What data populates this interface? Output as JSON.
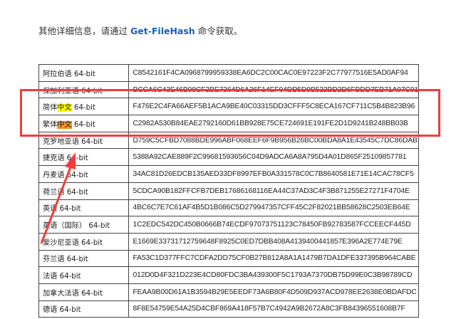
{
  "intro": {
    "prefix": "其他详细信息，请通过 ",
    "command": "Get-FileHash",
    "suffix": " 命令获取。"
  },
  "rows": [
    {
      "lang": "阿拉伯语 64-bit",
      "hash": "C8542161F4CA0968799959338EA6DC2C00CAC0E97223F2C77977516E5AD0AF94"
    },
    {
      "lang": "保加利亚语 64-bit",
      "hash": "BCCA6C43E46B08CF2BE7364D6A26F14EF04DD5D9B522BD2D6FBDD7EB71A07C01"
    },
    {
      "lang_pre": "简体",
      "lang_hl": "中文",
      "lang_post": " 64-bit",
      "hash": "F476E2C4FA66AEF5B1ACA9BE40C03315DD3CFFF5C8ECA167CF711C5B4B823B96"
    },
    {
      "lang_pre": "繁体",
      "lang_hl": "中文",
      "lang_post": " 64-bit",
      "hash": "C2982A530B84EAE2792160D61BB928E75CE724691E191FE2D1D9241B248BB03B"
    },
    {
      "lang": "克罗地亚语 64-bit",
      "hash": "D759C5CFBD7088BDE996ABF068EEF6F9B956B26BC00BDA8A1E43545C7DC86DAB"
    },
    {
      "lang": "捷克语 64-bit",
      "hash": "5388A92CAE889F2C99681593656C04D9ADCA6A8A795D4A01D865F25109857781"
    },
    {
      "lang": "丹麦语 64-bit",
      "hash": "34AC81D26EDCB135AED33DF8997EFB0A331578C0C7B8640581E71E14CAC78CF5"
    },
    {
      "lang": "荷兰语 64-bit",
      "hash": "5CDCA90B182FFCFB7DEB17686168116EA44C37AD3C4F3B871255E27271F4704E"
    },
    {
      "lang": "英语 64-bit",
      "hash": "4BC6C7E7C61AF4B5D1B086C5D279947357CFF45C2F82021BB58628C2503EB64E"
    },
    {
      "lang": "英语（国际） 64-bit",
      "hash": "1C2EDC542DC450B0666B74ECDF97073751123C78450FB92783587FCCEECF445D"
    },
    {
      "lang": "爱沙尼亚语 64-bit",
      "hash": "E1669E33731712759648F8925C0ED7DBB408A4139400441857E396A2E774E79E"
    },
    {
      "lang": "芬兰语 64-bit",
      "hash": "FA53C1D377FFC7CDFA2DD75CF0B27B812A8A1A1479B7DA1DFE337395B964CABE"
    },
    {
      "lang": "法语 64-bit",
      "hash": "012D0D4F321D223E4CD80FDC3BA439300F5C1793A7370DB75D99E0C3B98789CD"
    },
    {
      "lang": "加拿大法语 64-bit",
      "hash": "FEAA9B00D61A1B3594B29E5EEDF73A6B80F4D509D937ACD978EE2638E0BDAFDC"
    },
    {
      "lang": "德语 64-bit",
      "hash": "8F8E54759E54A25D4CBF869A418F57B7C4942A9B2672A8C3FB84396551608B7F"
    }
  ],
  "colors": {
    "annotation": "#f23c3c",
    "highlight_yellow": "#ffff00",
    "highlight_orange": "#f7941d"
  }
}
